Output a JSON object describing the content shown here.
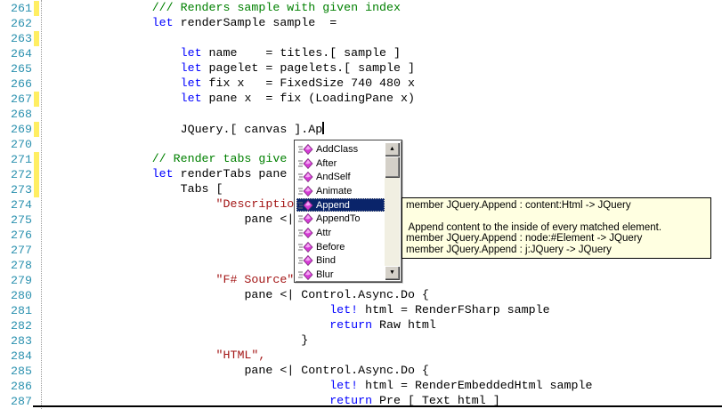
{
  "colors": {
    "keyword": "#0000ff",
    "comment": "#008000",
    "string": "#a31515",
    "plain": "#000000",
    "line_number": "#2b91af",
    "change_bar": "#ffee62",
    "selection_bg": "#0a246a",
    "tooltip_bg": "#ffffe1",
    "popup_chrome": "#d4d0c8"
  },
  "editor": {
    "lines": [
      {
        "n": 261,
        "changed": true,
        "indent": 15,
        "parts": [
          {
            "s": "cm",
            "t": "/// Renders sample with given index"
          }
        ]
      },
      {
        "n": 262,
        "changed": false,
        "indent": 15,
        "parts": [
          {
            "s": "kw",
            "t": "let"
          },
          {
            "s": "pl",
            "t": " renderSample sample  ="
          }
        ]
      },
      {
        "n": 263,
        "changed": true,
        "indent": 0,
        "parts": []
      },
      {
        "n": 264,
        "changed": false,
        "indent": 19,
        "parts": [
          {
            "s": "kw",
            "t": "let"
          },
          {
            "s": "pl",
            "t": " name    = titles.[ sample ]"
          }
        ]
      },
      {
        "n": 265,
        "changed": false,
        "indent": 19,
        "parts": [
          {
            "s": "kw",
            "t": "let"
          },
          {
            "s": "pl",
            "t": " pagelet = pagelets.[ sample ]"
          }
        ]
      },
      {
        "n": 266,
        "changed": false,
        "indent": 19,
        "parts": [
          {
            "s": "kw",
            "t": "let"
          },
          {
            "s": "pl",
            "t": " fix x   = FixedSize 740 480 x"
          }
        ]
      },
      {
        "n": 267,
        "changed": true,
        "indent": 19,
        "parts": [
          {
            "s": "kw",
            "t": "let"
          },
          {
            "s": "pl",
            "t": " pane x  = fix (LoadingPane x)"
          }
        ]
      },
      {
        "n": 268,
        "changed": false,
        "indent": 0,
        "parts": []
      },
      {
        "n": 269,
        "changed": true,
        "indent": 19,
        "parts": [
          {
            "s": "pl",
            "t": "JQuery.[ canvas ].Ap"
          },
          {
            "s": "cursor",
            "t": ""
          }
        ]
      },
      {
        "n": 270,
        "changed": false,
        "indent": 0,
        "parts": []
      },
      {
        "n": 271,
        "changed": true,
        "indent": 15,
        "parts": [
          {
            "s": "cm",
            "t": "// Render tabs give"
          }
        ]
      },
      {
        "n": 272,
        "changed": true,
        "indent": 15,
        "parts": [
          {
            "s": "kw",
            "t": "let"
          },
          {
            "s": "pl",
            "t": " renderTabs pane"
          }
        ]
      },
      {
        "n": 273,
        "changed": true,
        "indent": 19,
        "parts": [
          {
            "s": "pl",
            "t": "Tabs ["
          }
        ]
      },
      {
        "n": 274,
        "changed": false,
        "indent": 24,
        "parts": [
          {
            "s": "str",
            "t": "\"Descriptio"
          }
        ]
      },
      {
        "n": 275,
        "changed": false,
        "indent": 28,
        "parts": [
          {
            "s": "pl",
            "t": "pane <|"
          }
        ]
      },
      {
        "n": 276,
        "changed": false,
        "indent": 0,
        "parts": []
      },
      {
        "n": 277,
        "changed": false,
        "indent": 0,
        "parts": []
      },
      {
        "n": 278,
        "changed": false,
        "indent": 0,
        "parts": []
      },
      {
        "n": 279,
        "changed": false,
        "indent": 24,
        "parts": [
          {
            "s": "str",
            "t": "\"F# Source\""
          }
        ]
      },
      {
        "n": 280,
        "changed": false,
        "indent": 28,
        "parts": [
          {
            "s": "pl",
            "t": "pane <| Control.Async.Do {"
          }
        ]
      },
      {
        "n": 281,
        "changed": false,
        "indent": 40,
        "parts": [
          {
            "s": "kw",
            "t": "let!"
          },
          {
            "s": "pl",
            "t": " html = RenderFSharp sample"
          }
        ]
      },
      {
        "n": 282,
        "changed": false,
        "indent": 40,
        "parts": [
          {
            "s": "kw",
            "t": "return"
          },
          {
            "s": "pl",
            "t": " Raw html"
          }
        ]
      },
      {
        "n": 283,
        "changed": false,
        "indent": 36,
        "parts": [
          {
            "s": "pl",
            "t": "}"
          }
        ]
      },
      {
        "n": 284,
        "changed": false,
        "indent": 24,
        "parts": [
          {
            "s": "str",
            "t": "\"HTML\","
          }
        ]
      },
      {
        "n": 285,
        "changed": false,
        "indent": 28,
        "parts": [
          {
            "s": "pl",
            "t": "pane <| Control.Async.Do {"
          }
        ]
      },
      {
        "n": 286,
        "changed": false,
        "indent": 40,
        "parts": [
          {
            "s": "kw",
            "t": "let!"
          },
          {
            "s": "pl",
            "t": " html = RenderEmbeddedHtml sample"
          }
        ]
      },
      {
        "n": 287,
        "changed": false,
        "indent": 40,
        "parts": [
          {
            "s": "kw",
            "t": "return"
          },
          {
            "s": "pl",
            "t": " Pre [ Text html ]"
          }
        ]
      }
    ]
  },
  "autocomplete": {
    "items": [
      "AddClass",
      "After",
      "AndSelf",
      "Animate",
      "Append",
      "AppendTo",
      "Attr",
      "Before",
      "Bind",
      "Blur"
    ],
    "selected_item": "Append",
    "item_icon": "method-gem-icon",
    "scroll_up_glyph": "▲",
    "scroll_down_glyph": "▼"
  },
  "tooltip": {
    "lines": [
      "member JQuery.Append : content:Html -> JQuery",
      "",
      " Append content to the inside of every matched element.",
      "member JQuery.Append : node:#Element -> JQuery",
      "member JQuery.Append : j:JQuery -> JQuery"
    ]
  }
}
